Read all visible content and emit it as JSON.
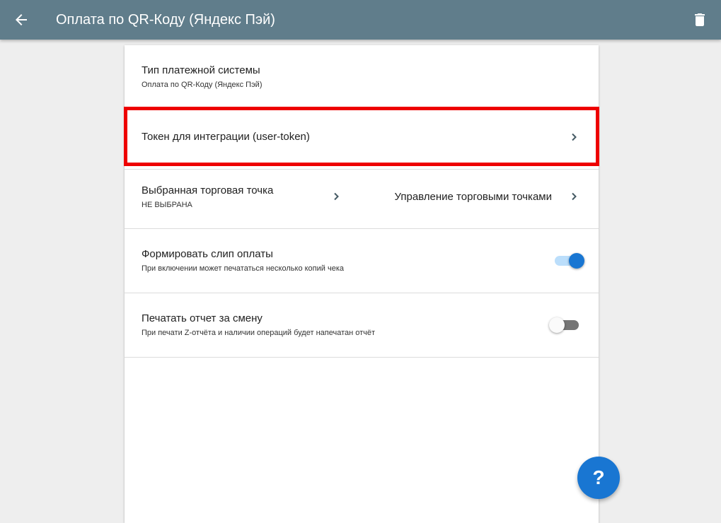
{
  "appbar": {
    "title": "Оплата по QR-Коду (Яндекс Пэй)",
    "back_icon": "arrow-left-icon",
    "delete_icon": "trash-icon",
    "background": "#607d8b"
  },
  "settings": {
    "payment_type": {
      "title": "Тип платежной системы",
      "value": "Оплата по QR-Коду (Яндекс Пэй)"
    },
    "token": {
      "title": "Токен для интеграции (user-token)",
      "highlighted": true,
      "highlight_color": "#ee0000"
    },
    "trade_point": {
      "title": "Выбранная торговая точка",
      "value": "НЕ ВЫБРАНА",
      "manage_label": "Управление торговыми точками"
    },
    "slip": {
      "title": "Формировать слип оплаты",
      "description": "При включении может печататься несколько копий чека",
      "enabled": true
    },
    "shift_report": {
      "title": "Печатать отчет за смену",
      "description": "При печати Z-отчёта и наличии операций будет напечатан отчёт",
      "enabled": false
    }
  },
  "help_button": {
    "label": "?",
    "color": "#1976d2"
  },
  "colors": {
    "toggle_on_thumb": "#1976d2",
    "toggle_on_track": "#bbdefb",
    "toggle_off_thumb": "#fafafa",
    "toggle_off_track": "#757575"
  }
}
